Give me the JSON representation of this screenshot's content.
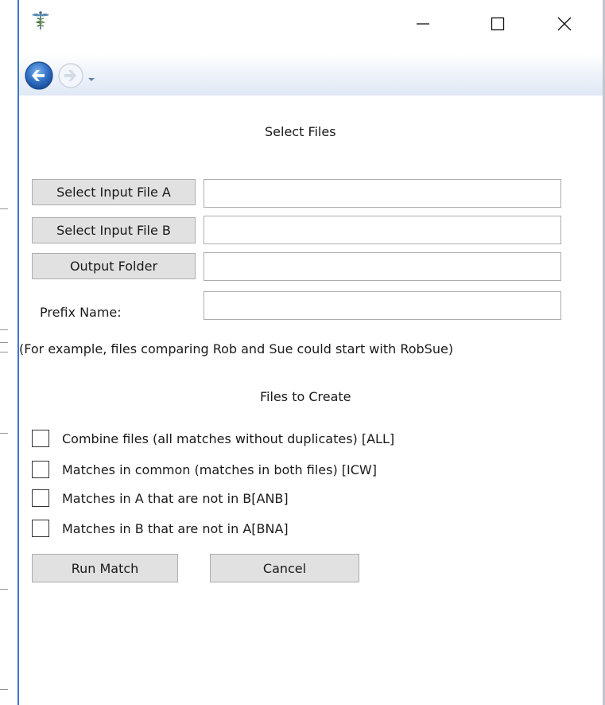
{
  "window": {
    "icon": "caduceus-icon",
    "controls": [
      "minimize-icon",
      "maximize-icon",
      "close-icon"
    ]
  },
  "nav": {
    "back_icon": "back-arrow-icon",
    "forward_icon": "forward-arrow-icon",
    "history_icon": "dropdown-arrow-icon"
  },
  "select_files": {
    "heading": "Select Files",
    "file_a_button": "Select Input File A",
    "file_a_value": "",
    "file_b_button": "Select Input File B",
    "file_b_value": "",
    "output_button": "Output Folder",
    "output_value": "",
    "prefix_label": "Prefix Name:",
    "prefix_value": "",
    "example_text": "(For example, files comparing Rob and Sue could start with RobSue)"
  },
  "files_to_create": {
    "heading": "Files to Create",
    "options": [
      {
        "label": "Combine files (all matches without duplicates) [ALL]",
        "checked": false
      },
      {
        "label": "Matches in common (matches in both files) [ICW]",
        "checked": false
      },
      {
        "label": "Matches in A that are not in B[ANB]",
        "checked": false
      },
      {
        "label": "Matches in B that are not in A[BNA]",
        "checked": false
      }
    ]
  },
  "actions": {
    "run_button": "Run Match",
    "cancel_button": "Cancel"
  },
  "colors": {
    "accent": "#3b78c8",
    "button_bg": "#e1e1e1",
    "button_border": "#adadad",
    "nav_gradient_end": "#dfe8f5"
  }
}
